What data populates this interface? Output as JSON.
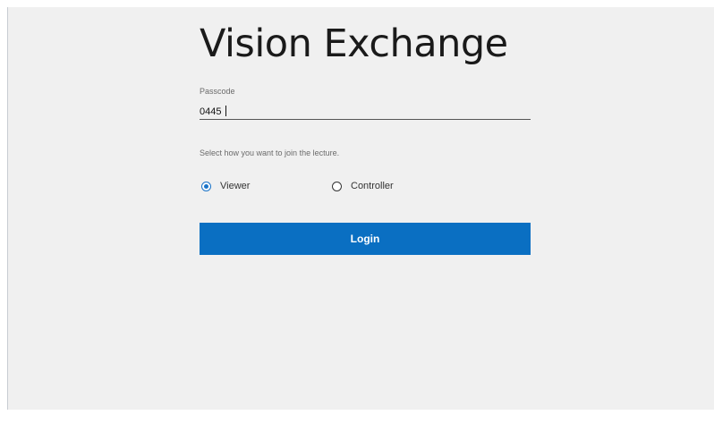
{
  "app": {
    "title": "Vision Exchange"
  },
  "form": {
    "passcode": {
      "label": "Passcode",
      "value": "0445"
    },
    "instruction": "Select how you want to join the lecture.",
    "join_options": [
      {
        "label": "Viewer",
        "selected": true
      },
      {
        "label": "Controller",
        "selected": false
      }
    ],
    "login_label": "Login"
  },
  "colors": {
    "accent": "#0a6fc2",
    "panel_background": "#f0f0f0"
  }
}
